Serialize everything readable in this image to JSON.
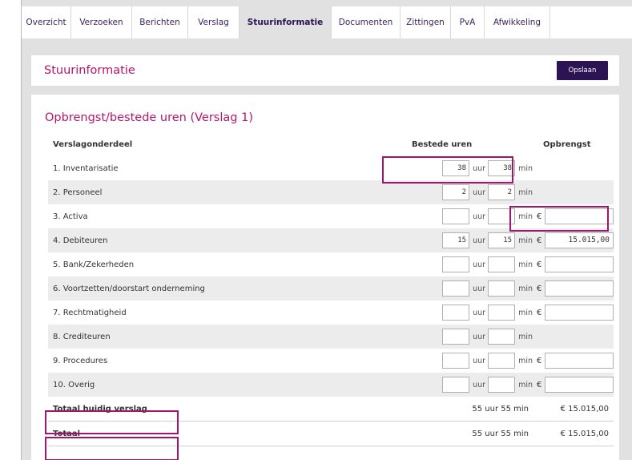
{
  "tabs": [
    {
      "label": "Overzicht",
      "active": false
    },
    {
      "label": "Verzoeken",
      "active": false
    },
    {
      "label": "Berichten",
      "active": false
    },
    {
      "label": "Verslag",
      "active": false
    },
    {
      "label": "Stuurinformatie",
      "active": true
    },
    {
      "label": "Documenten",
      "active": false
    },
    {
      "label": "Zittingen",
      "active": false
    },
    {
      "label": "PvA",
      "active": false
    },
    {
      "label": "Afwikkeling",
      "active": false
    }
  ],
  "header": {
    "title": "Stuurinformatie",
    "save_label": "Opslaan"
  },
  "section": {
    "title": "Opbrengst/bestede uren (Verslag 1)"
  },
  "table": {
    "columns": [
      "Verslagonderdeel",
      "Bestede uren",
      "Opbrengst"
    ],
    "hour_unit": "uur",
    "min_unit": "min",
    "currency": "€",
    "rows": [
      {
        "label": "1. Inventarisatie",
        "hours": "38",
        "minutes": "38",
        "has_revenue": false,
        "revenue": ""
      },
      {
        "label": "2. Personeel",
        "hours": "2",
        "minutes": "2",
        "has_revenue": false,
        "revenue": ""
      },
      {
        "label": "3. Activa",
        "hours": "",
        "minutes": "",
        "has_revenue": true,
        "revenue": ""
      },
      {
        "label": "4. Debiteuren",
        "hours": "15",
        "minutes": "15",
        "has_revenue": true,
        "revenue": "15.015,00"
      },
      {
        "label": "5. Bank/Zekerheden",
        "hours": "",
        "minutes": "",
        "has_revenue": true,
        "revenue": ""
      },
      {
        "label": "6. Voortzetten/doorstart onderneming",
        "hours": "",
        "minutes": "",
        "has_revenue": true,
        "revenue": ""
      },
      {
        "label": "7. Rechtmatigheid",
        "hours": "",
        "minutes": "",
        "has_revenue": true,
        "revenue": ""
      },
      {
        "label": "8. Crediteuren",
        "hours": "",
        "minutes": "",
        "has_revenue": false,
        "revenue": ""
      },
      {
        "label": "9. Procedures",
        "hours": "",
        "minutes": "",
        "has_revenue": true,
        "revenue": ""
      },
      {
        "label": "10. Overig",
        "hours": "",
        "minutes": "",
        "has_revenue": true,
        "revenue": ""
      }
    ],
    "totals": [
      {
        "label": "Totaal huidig verslag",
        "time": "55 uur 55 min",
        "revenue": "€ 15.015,00"
      },
      {
        "label": "Totaal",
        "time": "55 uur 55 min",
        "revenue": "€ 15.015,00"
      }
    ]
  },
  "colors": {
    "accent": "#b4156e",
    "brand": "#2c1454",
    "highlight": "#a1166c"
  }
}
